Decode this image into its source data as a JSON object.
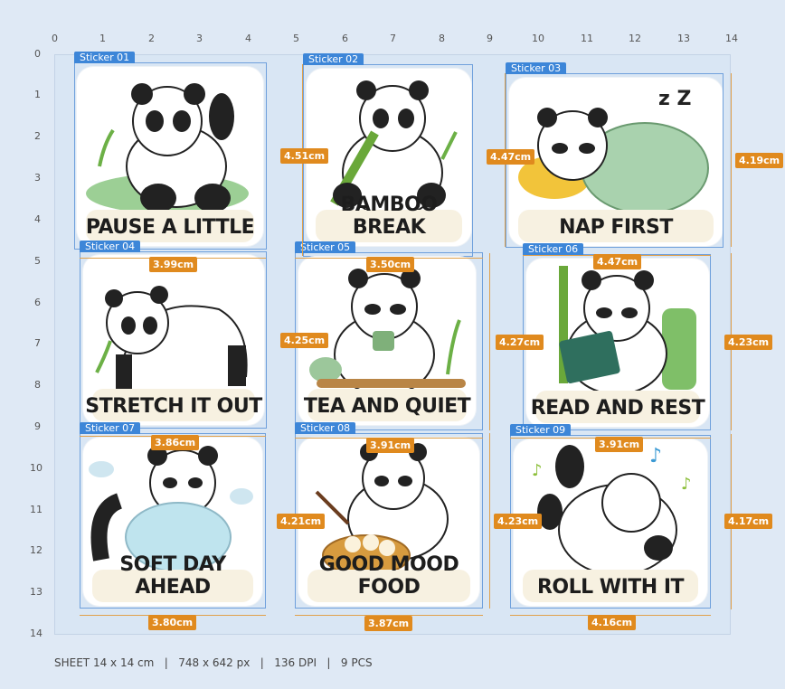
{
  "ruler": {
    "top": [
      "0",
      "1",
      "2",
      "3",
      "4",
      "5",
      "6",
      "7",
      "8",
      "9",
      "10",
      "11",
      "12",
      "13",
      "14"
    ],
    "left": [
      "0",
      "1",
      "2",
      "3",
      "4",
      "5",
      "6",
      "7",
      "8",
      "9",
      "10",
      "11",
      "12",
      "13",
      "14"
    ]
  },
  "stickers": [
    {
      "tag": "Sticker 01",
      "caption": "PAUSE A LITTLE",
      "scene": "waving"
    },
    {
      "tag": "Sticker 02",
      "caption": "BAMBOO BREAK",
      "scene": "bamboo"
    },
    {
      "tag": "Sticker 03",
      "caption": "NAP FIRST",
      "scene": "nap"
    },
    {
      "tag": "Sticker 04",
      "caption": "STRETCH IT OUT",
      "scene": "stretch"
    },
    {
      "tag": "Sticker 05",
      "caption": "TEA AND QUIET",
      "scene": "tea"
    },
    {
      "tag": "Sticker 06",
      "caption": "READ AND REST",
      "scene": "read"
    },
    {
      "tag": "Sticker 07",
      "caption": "SOFT DAY AHEAD",
      "scene": "cloud"
    },
    {
      "tag": "Sticker 08",
      "caption": "GOOD MOOD FOOD",
      "scene": "food"
    },
    {
      "tag": "Sticker 09",
      "caption": "ROLL WITH IT",
      "scene": "roll"
    }
  ],
  "dimensions": {
    "s02_h": "4.51cm",
    "s03_left": "4.47cm",
    "s03_right": "4.19cm",
    "s04_w": "3.99cm",
    "s05_w": "3.50cm",
    "s05_h": "4.25cm",
    "s06_w": "4.47cm",
    "s06_left": "4.27cm",
    "s06_right": "4.23cm",
    "s07_w": "3.86cm",
    "s08_w": "3.91cm",
    "s08_h": "4.21cm",
    "s09_w": "3.91cm",
    "s09_left": "4.23cm",
    "s09_right": "4.17cm",
    "b07": "3.80cm",
    "b08": "3.87cm",
    "b09": "4.16cm"
  },
  "footer": "SHEET 14 x 14 cm   |   748 x 642 px   |   136 DPI   |   9 PCS",
  "colors": {
    "accent": "#3d86d8",
    "dimension": "#e08a1e",
    "sheet": "#d9e6f4"
  }
}
